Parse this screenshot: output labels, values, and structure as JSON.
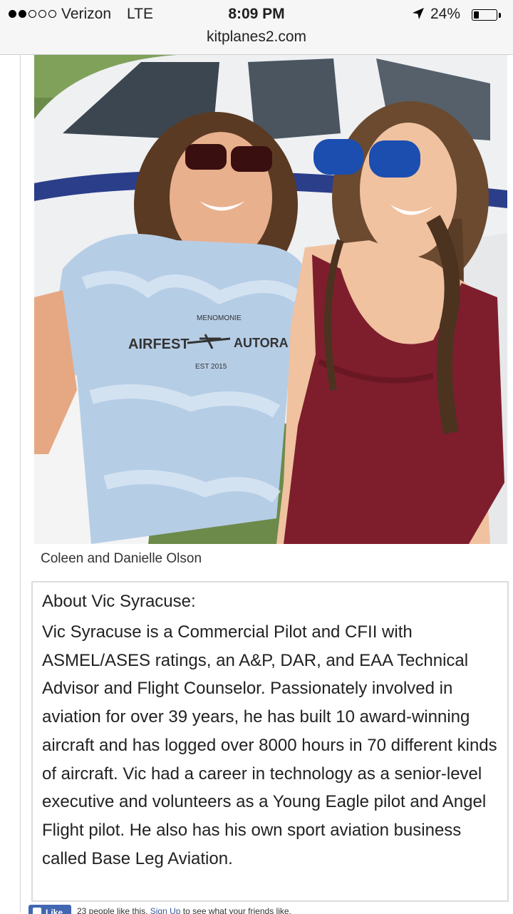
{
  "status_bar": {
    "carrier": "Verizon",
    "network": "LTE",
    "time": "8:09 PM",
    "battery_percent": "24%",
    "battery_level": 0.24,
    "signal_bars_filled": 2,
    "signal_bars_total": 5,
    "location_icon": "location-arrow-icon"
  },
  "browser": {
    "url": "kitplanes2.com"
  },
  "article": {
    "photo": {
      "shirt_lines": [
        "MENOMONIE",
        "AIRFEST",
        "AUTORA",
        "EST 2015"
      ]
    },
    "caption": "Coleen and Danielle Olson",
    "bio": {
      "heading": "About Vic Syracuse:",
      "body": "Vic Syracuse is a Commercial Pilot and CFII with ASMEL/ASES ratings, an A&P, DAR, and EAA Technical Advisor and Flight Counselor. Passionately involved in aviation for over 39 years, he has built 10 award-winning aircraft and has logged over 8000 hours in 70 different kinds of aircraft. Vic had a career in technology as a senior-level executive and volunteers as a Young Eagle pilot and Angel Flight pilot. He also has his own sport aviation business called Base Leg Aviation."
    }
  },
  "facebook": {
    "like_label": "Like",
    "count_text": "23 people like this.",
    "signup_link": "Sign Up",
    "signup_suffix": "to see what your friends like."
  },
  "colors": {
    "status_bar_bg": "#f6f6f7",
    "facebook_blue": "#4267b2",
    "link": "#3b5998"
  }
}
